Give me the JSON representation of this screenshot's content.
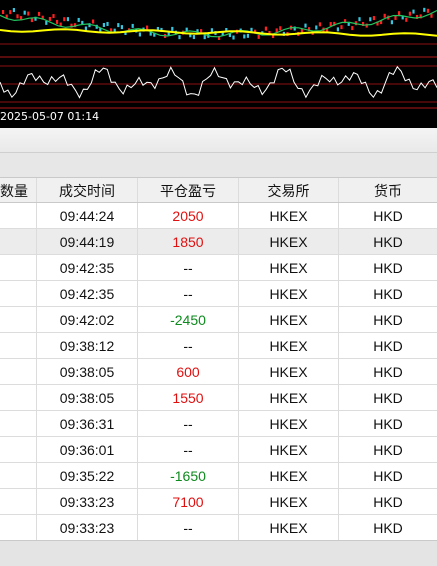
{
  "chart": {
    "timestamp": "2025-05-07 01:14",
    "colors": {
      "background": "#000000",
      "red": "#ff2020",
      "green": "#22c55e",
      "yellow": "#ffff00",
      "white": "#ffffff",
      "cyan": "#36c8e0"
    }
  },
  "table": {
    "columns": [
      "数量",
      "成交时间",
      "平仓盈亏",
      "交易所",
      "货币"
    ],
    "rows": [
      {
        "time": "09:44:24",
        "pnl": "2050",
        "sign": "pos",
        "exchange": "HKEX",
        "currency": "HKD"
      },
      {
        "time": "09:44:19",
        "pnl": "1850",
        "sign": "pos",
        "exchange": "HKEX",
        "currency": "HKD"
      },
      {
        "time": "09:42:35",
        "pnl": "--",
        "sign": "none",
        "exchange": "HKEX",
        "currency": "HKD"
      },
      {
        "time": "09:42:35",
        "pnl": "--",
        "sign": "none",
        "exchange": "HKEX",
        "currency": "HKD"
      },
      {
        "time": "09:42:02",
        "pnl": "-2450",
        "sign": "neg",
        "exchange": "HKEX",
        "currency": "HKD"
      },
      {
        "time": "09:38:12",
        "pnl": "--",
        "sign": "none",
        "exchange": "HKEX",
        "currency": "HKD"
      },
      {
        "time": "09:38:05",
        "pnl": "600",
        "sign": "pos",
        "exchange": "HKEX",
        "currency": "HKD"
      },
      {
        "time": "09:38:05",
        "pnl": "1550",
        "sign": "pos",
        "exchange": "HKEX",
        "currency": "HKD"
      },
      {
        "time": "09:36:31",
        "pnl": "--",
        "sign": "none",
        "exchange": "HKEX",
        "currency": "HKD"
      },
      {
        "time": "09:36:01",
        "pnl": "--",
        "sign": "none",
        "exchange": "HKEX",
        "currency": "HKD"
      },
      {
        "time": "09:35:22",
        "pnl": "-1650",
        "sign": "neg",
        "exchange": "HKEX",
        "currency": "HKD"
      },
      {
        "time": "09:33:23",
        "pnl": "7100",
        "sign": "pos",
        "exchange": "HKEX",
        "currency": "HKD"
      },
      {
        "time": "09:33:23",
        "pnl": "--",
        "sign": "none",
        "exchange": "HKEX",
        "currency": "HKD"
      }
    ]
  }
}
